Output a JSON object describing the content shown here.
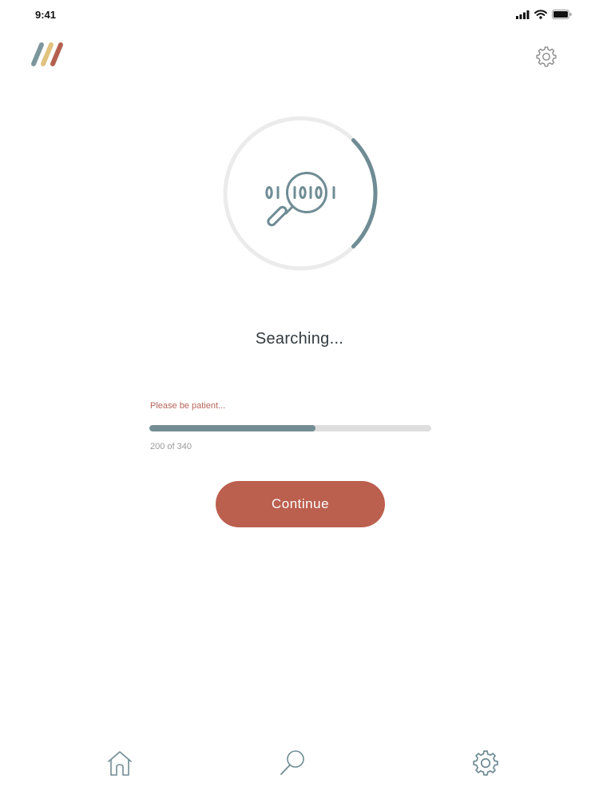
{
  "status_bar": {
    "time": "9:41",
    "icons": [
      "cellular-signal-icon",
      "wifi-icon",
      "battery-icon"
    ]
  },
  "header": {
    "logo": "three-stripes-logo",
    "logo_colors": [
      "#7c979b",
      "#e1c27f",
      "#b5604f"
    ],
    "settings_icon": "gear-icon"
  },
  "search_progress": {
    "ring_icon": "binary-magnifier-icon",
    "ring_fraction": 0.25,
    "ring_color": "#6f8c94",
    "ring_track_color": "#ebebeb"
  },
  "main": {
    "title": "Searching...",
    "patience_text": "Please be patient...",
    "progress": {
      "current": 200,
      "total": 340,
      "label": "200 of 340",
      "fill_color": "#748d95",
      "track_color": "#dedede"
    },
    "continue_label": "Continue",
    "button_color": "#bb5f4f",
    "accent_text_color": "#b8645a"
  },
  "tab_bar": {
    "items": [
      {
        "name": "home",
        "icon": "home-icon"
      },
      {
        "name": "search",
        "icon": "magnifier-icon"
      },
      {
        "name": "settings",
        "icon": "gear-icon"
      }
    ]
  }
}
